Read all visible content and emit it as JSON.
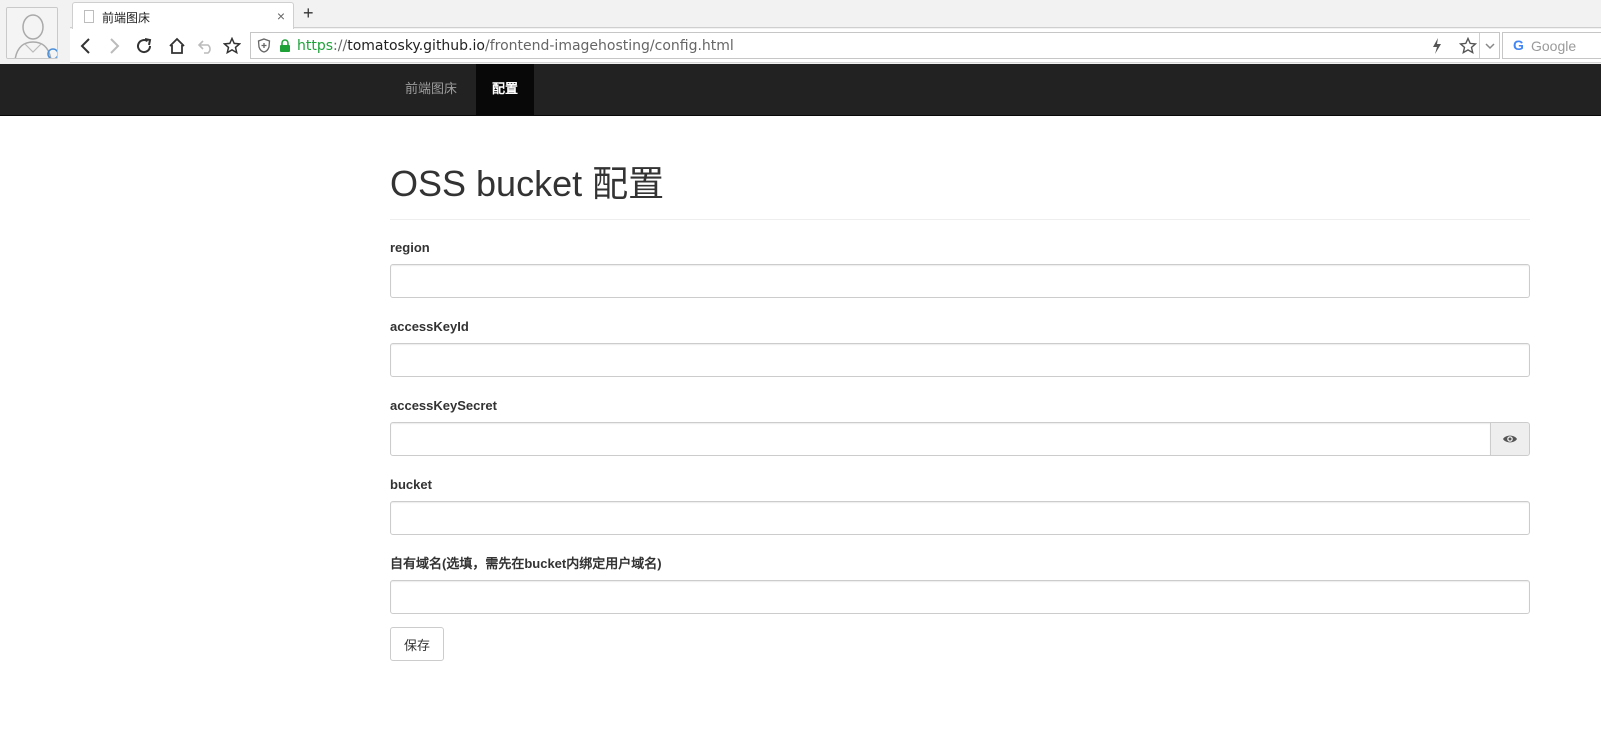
{
  "browser": {
    "tab_title": "前端图床",
    "tab_close": "×",
    "new_tab": "+",
    "url_scheme": "https",
    "url_sep": "://",
    "url_host": "tomatosky.github.io",
    "url_path": "/frontend-imagehosting/config.html",
    "search_placeholder": "Google",
    "search_logo": "G"
  },
  "navbar": {
    "brand": "前端图床",
    "active_item": "配置"
  },
  "page": {
    "title": "OSS bucket 配置"
  },
  "form": {
    "fields": [
      {
        "label": "region",
        "value": ""
      },
      {
        "label": "accessKeyId",
        "value": ""
      },
      {
        "label": "accessKeySecret",
        "value": ""
      },
      {
        "label": "bucket",
        "value": ""
      },
      {
        "label": "自有域名(选填，需先在bucket内绑定用户域名)",
        "value": ""
      }
    ],
    "save_label": "保存"
  },
  "colors": {
    "navbar_bg": "#222222",
    "navbar_active_bg": "#080808",
    "url_secure": "#1ea238"
  }
}
